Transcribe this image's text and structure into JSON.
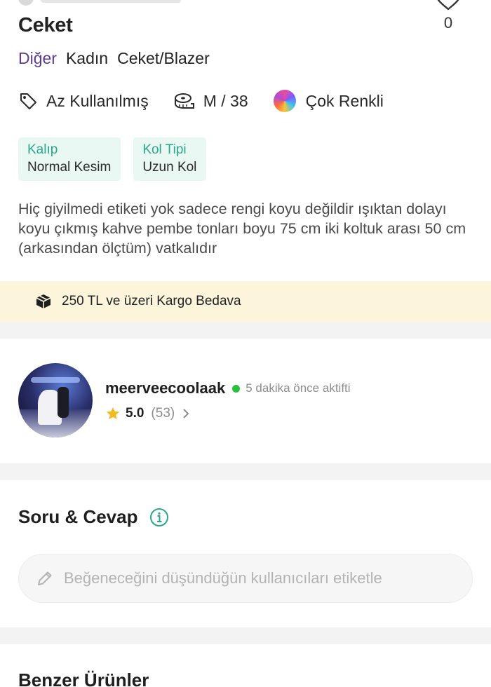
{
  "product": {
    "title": "Ceket",
    "like_count": "0"
  },
  "breadcrumb": {
    "brand": "Diğer",
    "items": [
      "Kadın",
      "Ceket/Blazer"
    ]
  },
  "attributes": {
    "condition": "Az Kullanılmış",
    "size": "M / 38",
    "color": "Çok Renkli"
  },
  "chips": [
    {
      "label": "Kalıp",
      "value": "Normal Kesim"
    },
    {
      "label": "Kol Tipi",
      "value": "Uzun Kol"
    }
  ],
  "description": "Hiç giyilmedi etiketi yok sadece rengi koyu değildir ışıktan dolayı koyu çıkmış kahve pembe tonları boyu 75 cm iki koltuk arası 50 cm (arkasından ölçtüm) vatkalıdır",
  "cargo": {
    "text": "250 TL ve üzeri Kargo Bedava"
  },
  "seller": {
    "username": "meerveecoolaak",
    "status": "5 dakika önce aktifti",
    "rating": "5.0",
    "rating_count": "(53)"
  },
  "qa": {
    "title": "Soru & Cevap",
    "tag_placeholder": "Beğeneceğini düşündüğün kullanıcıları etiketle"
  },
  "similar": {
    "title": "Benzer Ürünler"
  },
  "colors": {
    "brand_purple": "#5b3c8f",
    "chip_green": "#2aa889",
    "chip_bg": "#eaf8f4",
    "cargo_bg": "#fcf5dc",
    "online_green": "#2bbf3f",
    "star_yellow": "#f5b920",
    "info_teal": "#2aa889"
  },
  "icons": {
    "like": "heart-icon",
    "condition": "tag-icon",
    "size": "tape-measure-icon",
    "cargo": "box-icon",
    "rating": "star-icon",
    "info": "info-icon",
    "tag_input": "pencil-icon"
  }
}
